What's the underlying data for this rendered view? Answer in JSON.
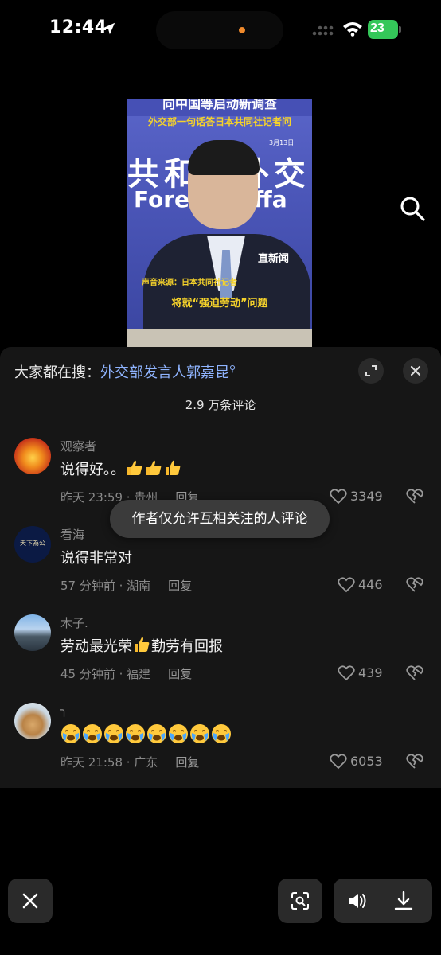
{
  "status_bar": {
    "time": "12:44",
    "battery": "23",
    "icons": [
      "location-arrow-icon",
      "signal-icon",
      "wifi-icon",
      "battery-charging-icon"
    ]
  },
  "video": {
    "headline": "向中国等启动新调查",
    "subheadline": "外交部一句话答日本共同社记者问",
    "date": "3月13日",
    "backdrop_cn": "共和国外交",
    "backdrop_en": "Foreign Affa",
    "watermark": "直新闻",
    "source": "声音来源：日本共同社记者",
    "caption": "将就“强迫劳动”问题"
  },
  "sheet": {
    "search_prefix": "大家都在搜：",
    "search_keyword": "外交部发言人郭嘉昆",
    "comment_count": "2.9 万条评论",
    "toast": "作者仅允许互相关注的人评论",
    "reply_label": "回复",
    "comments": [
      {
        "name": "观察者",
        "text": "说得好。。",
        "thumbs": 3,
        "meta": "昨天 23:59 · 贵州",
        "likes": "3349"
      },
      {
        "name": "看海",
        "text": "说得非常对",
        "meta": "57 分钟前 · 湖南",
        "likes": "446",
        "avatar_text": "天下為公"
      },
      {
        "name": "木子.",
        "text_before": "劳动最光荣",
        "text_after": "勤劳有回报",
        "meta": "45 分钟前 · 福建",
        "likes": "439"
      },
      {
        "name": "╮",
        "cry_emojis": 8,
        "meta": "昨天 21:58 · 广东",
        "likes": "6053"
      }
    ]
  },
  "colors": {
    "sheet_bg": "#161616",
    "keyword": "#8fb4ff",
    "muted": "#8a8a8a",
    "battery": "#34c759"
  }
}
